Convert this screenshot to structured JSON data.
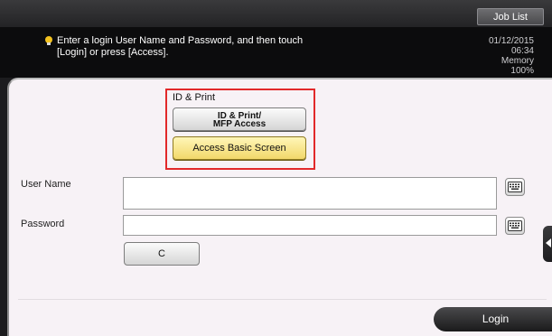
{
  "header": {
    "job_list_label": "Job List"
  },
  "message": {
    "icon": "lightbulb-icon",
    "text": "Enter a login User Name and Password, and then touch\n[Login] or press [Access]."
  },
  "status": {
    "date": "01/12/2015",
    "time": "06:34",
    "memory_label": "Memory",
    "memory_value": "100%"
  },
  "id_print": {
    "section_label": "ID & Print",
    "mfp_button_line1": "ID & Print/",
    "mfp_button_line2": "MFP Access",
    "basic_screen_button": "Access Basic Screen",
    "highlight_color": "#e2292a"
  },
  "form": {
    "username_label": "User Name",
    "username_value": "",
    "password_label": "Password",
    "password_value": "",
    "keyboard_icon": "keyboard-icon",
    "clear_button": "C"
  },
  "footer": {
    "login_button": "Login"
  },
  "side_tab": {
    "icon": "chevron-left-icon"
  }
}
